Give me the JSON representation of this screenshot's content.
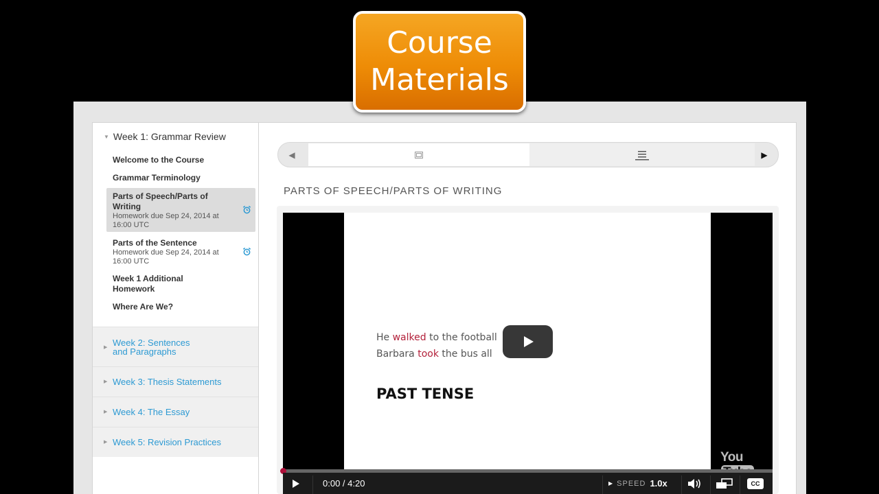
{
  "badge": {
    "line1": "Course",
    "line2": "Materials"
  },
  "sidebar": {
    "week1_title": "Week 1: Grammar Review",
    "items": [
      {
        "label": "Welcome to the Course"
      },
      {
        "label": "Grammar Terminology"
      },
      {
        "label_line1": "Parts of Speech/Parts of",
        "label_line2": "Writing",
        "sub_line1": "Homework due Sep 24, 2014 at",
        "sub_line2": "16:00 UTC",
        "active": true
      },
      {
        "label": "Parts of the Sentence",
        "sub_line1": "Homework due Sep 24, 2014 at",
        "sub_line2": "16:00 UTC"
      },
      {
        "label_line1": "Week 1 Additional",
        "label_line2": "Homework"
      },
      {
        "label": "Where Are We?"
      }
    ],
    "weeks": [
      {
        "line1": "Week 2: Sentences",
        "line2": "and Paragraphs"
      },
      {
        "line1": "Week 3: Thesis Statements"
      },
      {
        "line1": "Week 4: The Essay"
      },
      {
        "line1": "Week 5: Revision Practices"
      }
    ]
  },
  "content": {
    "section_title": "PARTS OF SPEECH/PARTS OF WRITING"
  },
  "video": {
    "slide": {
      "line1_pre": "He ",
      "line1_hl": "walked",
      "line1_post": " to the football",
      "line2_pre": "Barbara ",
      "line2_hl": "took",
      "line2_post": " the bus all",
      "title": "PAST TENSE"
    },
    "logo_you": "You",
    "logo_tube": "Tube",
    "time": "0:00 / 4:20",
    "speed_label": "SPEED",
    "speed_value": "1.0x",
    "cc_label": "CC",
    "progress": 0.0
  },
  "colors": {
    "accent": "#2d9ad3",
    "highlight": "#b3203a",
    "badge": "#ee8c06",
    "progress": "#b0103a"
  },
  "icons": [
    "chevron-left-icon",
    "slides-icon",
    "list-icon",
    "chevron-right-icon",
    "alarm-clock-icon",
    "play-icon",
    "volume-icon",
    "popout-icon",
    "cc-icon"
  ]
}
